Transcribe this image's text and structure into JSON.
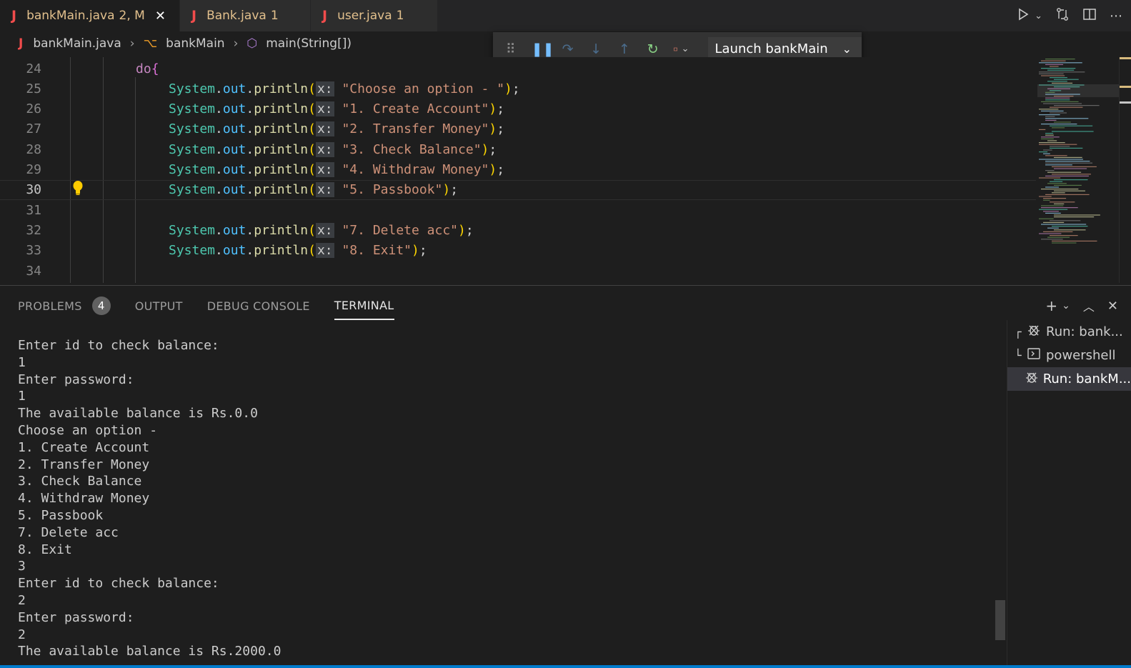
{
  "tabs": [
    {
      "label": "bankMain.java",
      "badge": "2, M",
      "active": true
    },
    {
      "label": "Bank.java",
      "badge": "1",
      "active": false
    },
    {
      "label": "user.java",
      "badge": "1",
      "active": false
    }
  ],
  "breadcrumb": {
    "file": "bankMain.java",
    "class": "bankMain",
    "method": "main(String[])"
  },
  "debug_toolbar": {
    "launch_config": "Launch bankMain"
  },
  "editor": {
    "current_line": 30,
    "lines": [
      {
        "num": "24",
        "kind": "do",
        "keyword": "do",
        "brace": "{"
      },
      {
        "num": "25",
        "kind": "println",
        "text": "\"Choose an option - \""
      },
      {
        "num": "26",
        "kind": "println",
        "text": "\"1. Create Account\""
      },
      {
        "num": "27",
        "kind": "println",
        "text": "\"2. Transfer Money\""
      },
      {
        "num": "28",
        "kind": "println",
        "text": "\"3. Check Balance\""
      },
      {
        "num": "29",
        "kind": "println",
        "text": "\"4. Withdraw Money\""
      },
      {
        "num": "30",
        "kind": "println",
        "text": "\"5. Passbook\""
      },
      {
        "num": "31",
        "kind": "empty"
      },
      {
        "num": "32",
        "kind": "println",
        "text": "\"7. Delete acc\""
      },
      {
        "num": "33",
        "kind": "println",
        "text": "\"8. Exit\""
      },
      {
        "num": "34",
        "kind": "empty"
      }
    ],
    "code_tokens": {
      "class": "System",
      "field": "out",
      "method": "println",
      "hint": "x:"
    }
  },
  "panel": {
    "tabs": [
      {
        "label": "PROBLEMS",
        "count": "4"
      },
      {
        "label": "OUTPUT"
      },
      {
        "label": "DEBUG CONSOLE"
      },
      {
        "label": "TERMINAL",
        "active": true
      }
    ],
    "terminal_lines": [
      "Enter id to check balance:",
      "1",
      "Enter password:",
      "1",
      "The available balance is Rs.0.0",
      "Choose an option -",
      "1. Create Account",
      "2. Transfer Money",
      "3. Check Balance",
      "4. Withdraw Money",
      "5. Passbook",
      "7. Delete acc",
      "8. Exit",
      "3",
      "Enter id to check balance:",
      "2",
      "Enter password:",
      "2",
      "The available balance is Rs.2000.0"
    ],
    "terminal_instances": [
      {
        "label": "Run: bank...",
        "icon": "debug-icon",
        "tree": "┌"
      },
      {
        "label": "powershell",
        "icon": "terminal-icon",
        "tree": "└"
      },
      {
        "label": "Run: bankM...",
        "icon": "debug-icon",
        "tree": "",
        "selected": true
      }
    ]
  },
  "colors": {
    "accent": "#007acc",
    "modified": "#e2c08d",
    "java_icon": "#f14c4c"
  }
}
